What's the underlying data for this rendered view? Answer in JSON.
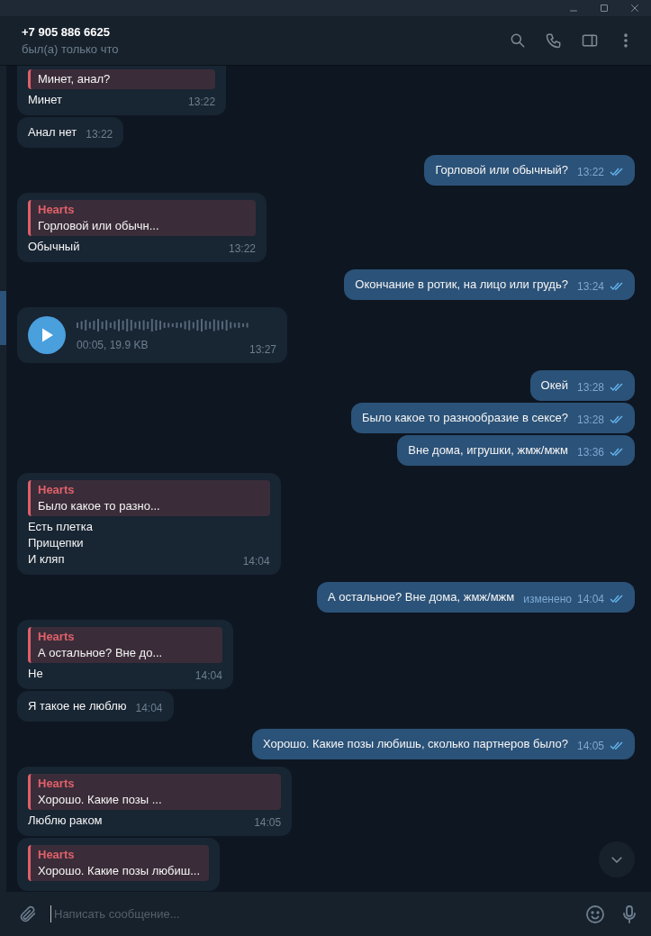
{
  "header": {
    "title": "+7 905 886 6625",
    "status": "был(а) только что"
  },
  "messages": [
    {
      "kind": "text",
      "out": false,
      "reply": {
        "text": "Минет, анал?"
      },
      "text": "Минет",
      "time": "13:22"
    },
    {
      "kind": "text",
      "out": false,
      "text": "Анал нет",
      "time": "13:22"
    },
    {
      "kind": "text",
      "out": true,
      "text": "Горловой или обычный?",
      "time": "13:22",
      "read": true
    },
    {
      "kind": "text",
      "out": false,
      "reply": {
        "name": "Hearts",
        "text": "Горловой или обычн..."
      },
      "text": "Обычный",
      "time": "13:22"
    },
    {
      "kind": "text",
      "out": true,
      "text": "Окончание в ротик, на лицо или грудь?",
      "time": "13:24",
      "read": true
    },
    {
      "kind": "voice",
      "out": false,
      "info": "00:05, 19.9 KB",
      "time": "13:27"
    },
    {
      "kind": "text",
      "out": true,
      "text": "Окей",
      "time": "13:28",
      "read": true
    },
    {
      "kind": "text",
      "out": true,
      "text": "Было какое то разнообразие в сексе?",
      "time": "13:28",
      "read": true
    },
    {
      "kind": "text",
      "out": true,
      "text": "Вне дома, игрушки, жмж/мжм",
      "time": "13:36",
      "read": true
    },
    {
      "kind": "text",
      "out": false,
      "reply": {
        "name": "Hearts",
        "text": "Было какое то разно..."
      },
      "text": "Есть плетка\nПрищепки\nИ кляп",
      "time": "14:04"
    },
    {
      "kind": "text",
      "out": true,
      "text": "А остальное? Вне дома, жмж/мжм",
      "edited": "изменено",
      "time": "14:04",
      "read": true
    },
    {
      "kind": "text",
      "out": false,
      "reply": {
        "name": "Hearts",
        "text": "А остальное? Вне до..."
      },
      "text": "Не",
      "time": "14:04"
    },
    {
      "kind": "text",
      "out": false,
      "text": "Я такое не люблю",
      "time": "14:04"
    },
    {
      "kind": "text",
      "out": true,
      "text": "Хорошо. Какие позы любишь, сколько партнеров было?",
      "time": "14:05",
      "read": true
    },
    {
      "kind": "text",
      "out": false,
      "reply": {
        "name": "Hearts",
        "text": "Хорошо. Какие позы ..."
      },
      "text": "Люблю раком",
      "time": "14:05"
    },
    {
      "kind": "text",
      "out": false,
      "reply": {
        "name": "Hearts",
        "text": "Хорошо. Какие позы любиш..."
      }
    }
  ],
  "composer": {
    "placeholder": "Написать сообщение..."
  }
}
